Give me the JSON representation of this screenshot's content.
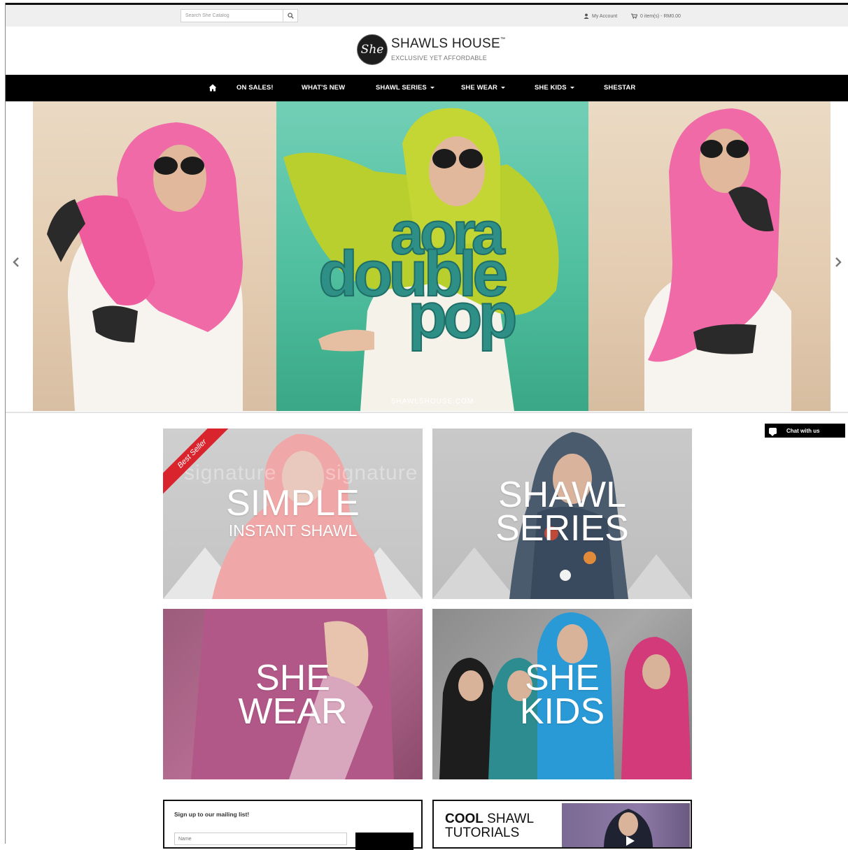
{
  "topbar": {
    "search_placeholder": "Search She Catalog",
    "account_label": "My Account",
    "cart_label": "0 item(s) - RM0.00"
  },
  "logo": {
    "mark": "She",
    "title": "SHAWLS HOUSE",
    "trademark": "™",
    "tagline": "EXCLUSIVE YET AFFORDABLE"
  },
  "nav": {
    "items": [
      {
        "label": "ON SALES!",
        "dropdown": false
      },
      {
        "label": "WHAT'S NEW",
        "dropdown": false
      },
      {
        "label": "SHAWL SERIES",
        "dropdown": true
      },
      {
        "label": "SHE WEAR",
        "dropdown": true
      },
      {
        "label": "SHE KIDS",
        "dropdown": true
      },
      {
        "label": "SHESTAR",
        "dropdown": false
      }
    ]
  },
  "slider": {
    "words": [
      "aora",
      "double",
      "pop"
    ],
    "url": "SHAWLSHOUSE.COM"
  },
  "chat": {
    "label": "Chat with us"
  },
  "categories": [
    {
      "line1": "SIMPLE",
      "line2": "INSTANT SHAWL",
      "badge": "Best Seller",
      "watermark": "signature"
    },
    {
      "line1": "SHAWL",
      "line2": "SERIES"
    },
    {
      "line1": "SHE",
      "line2": "WEAR"
    },
    {
      "line1": "SHE",
      "line2": "KIDS"
    }
  ],
  "mailing": {
    "title": "Sign up to our mailing list!",
    "name_placeholder": "Name"
  },
  "tutorial": {
    "bold": "COOL",
    "rest": " SHAWL",
    "line2": "TUTORIALS"
  },
  "colors": {
    "nav_bg": "#000000",
    "badge": "#d9232d",
    "aora_text": "#2e8f86"
  }
}
